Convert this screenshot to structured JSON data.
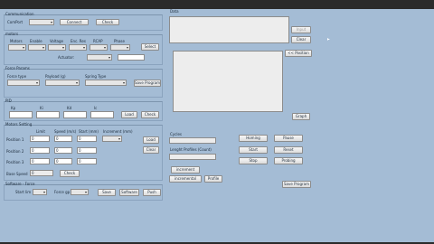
{
  "communication": {
    "title": "Communication",
    "comport_label": "ComPort",
    "comport_value": "",
    "connect": "Connect",
    "check": "Check"
  },
  "motors": {
    "title": "motors",
    "headers": [
      "Motors",
      "Enable",
      "Voltage",
      "Enc. Res",
      "RCAP",
      "Phase"
    ],
    "select": "Select",
    "actuator_label": "Actuator:"
  },
  "force_params": {
    "title": "Force Params",
    "headers": [
      "Force type",
      "Payload (g)",
      "Spring Type"
    ],
    "save_program": "Save Program"
  },
  "pid": {
    "title": "PID",
    "headers": [
      "Kp",
      "Ki",
      "Kd",
      "Ic"
    ],
    "load": "Load",
    "check": "Check"
  },
  "motors_setting": {
    "title": "Motors Setting",
    "col_headers": [
      "Limit",
      "Speed (m/s)",
      "Start (mm)",
      "Increment (mm)"
    ],
    "rows": [
      {
        "label": "Position 1",
        "values": [
          "0",
          "0",
          "0"
        ]
      },
      {
        "label": "Position 2",
        "values": [
          "0",
          "0",
          "0"
        ]
      },
      {
        "label": "Position 3",
        "values": [
          "0",
          "0",
          "0"
        ]
      }
    ],
    "load": "Load",
    "clear": "Clear",
    "base_speed_label": "Base Speed",
    "base_speed_value": "0",
    "check": "Check"
  },
  "software_force": {
    "title": "Software - Force",
    "start_lim_label": "Start lim",
    "force_gp_label": "Force gp",
    "save": "Save",
    "software": "Software",
    "push": "Push"
  },
  "data": {
    "title": "Data",
    "input_btn": "Input",
    "clear": "Clear",
    "position": "<< Position",
    "graph": "Graph"
  },
  "cycles": {
    "label": "Cycles",
    "value": "",
    "lenght_label": "Lenght Profiles (Count)",
    "value2": ""
  },
  "actions": {
    "increment": "increment",
    "incremental": "incremental",
    "profile": "Profile",
    "homing": "Homing",
    "pause": "Pause",
    "start": "Start",
    "reset": "Reset",
    "stop": "Stop",
    "probing": "Probing",
    "save_program": "Save Program"
  }
}
